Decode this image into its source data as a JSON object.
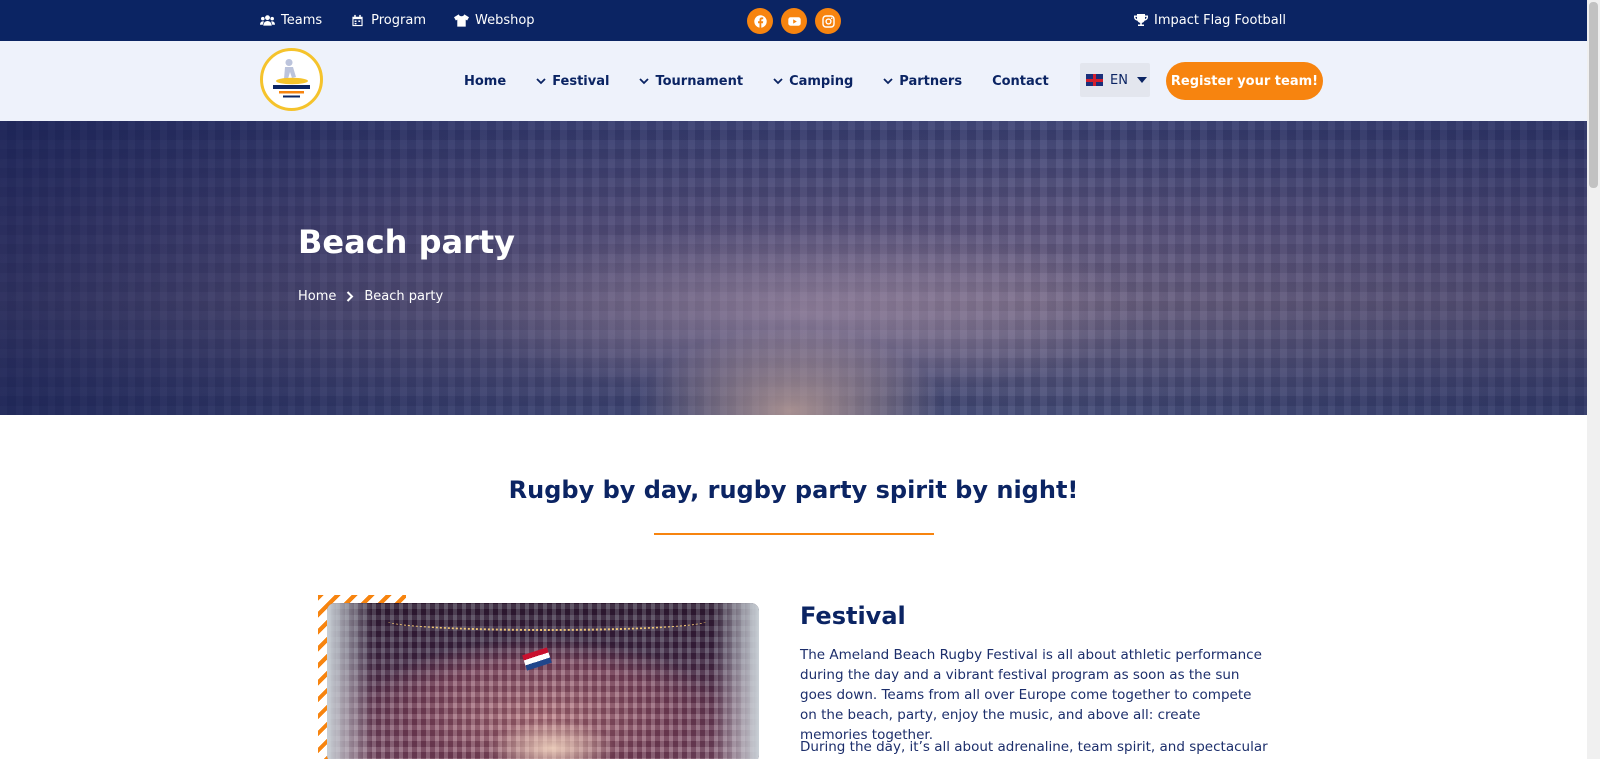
{
  "topbar": {
    "links": [
      {
        "label": "Teams",
        "icon": "users-icon"
      },
      {
        "label": "Program",
        "icon": "calendar-icon"
      },
      {
        "label": "Webshop",
        "icon": "tshirt-icon"
      }
    ],
    "socials": [
      "facebook-icon",
      "youtube-icon",
      "instagram-icon"
    ],
    "impact_label": "Impact Flag Football",
    "impact_icon": "trophy-icon"
  },
  "nav": {
    "logo_alt": "Beachrugby Ameland logo",
    "items": [
      {
        "label": "Home",
        "dropdown": false
      },
      {
        "label": "Festival",
        "dropdown": true
      },
      {
        "label": "Tournament",
        "dropdown": true
      },
      {
        "label": "Camping",
        "dropdown": true
      },
      {
        "label": "Partners",
        "dropdown": true
      },
      {
        "label": "Contact",
        "dropdown": false
      }
    ],
    "language": "EN",
    "register_label": "Register your team!"
  },
  "hero": {
    "title": "Beach party",
    "breadcrumb": [
      "Home",
      "Beach party"
    ]
  },
  "content": {
    "headline": "Rugby by day, rugby party spirit by night!",
    "section_title": "Festival",
    "paragraph1": "The Ameland Beach Rugby Festival is all about athletic performance during the day and a vibrant festival program as soon as the sun goes down. Teams from all over Europe come together to compete on the beach, party, enjoy the music, and above all: create memories together.",
    "paragraph2": "During the day, it’s all about adrenaline, team spirit, and spectacular rugby"
  },
  "colors": {
    "navy": "#0b2463",
    "orange": "#f7840f",
    "nav_bg": "#eef2fb"
  }
}
